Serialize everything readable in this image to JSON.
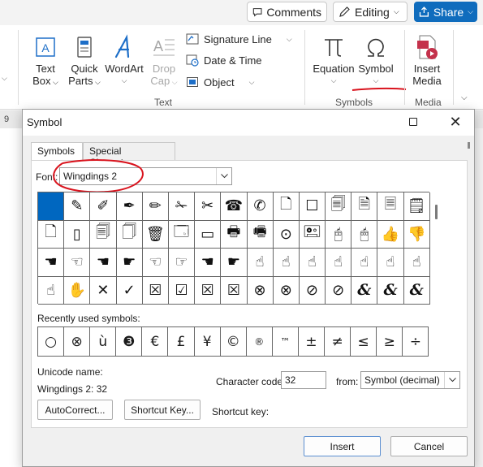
{
  "toolbar": {
    "comments_label": "Comments",
    "editing_label": "Editing",
    "share_label": "Share"
  },
  "ribbon": {
    "text_box": {
      "line1": "Text",
      "line2": "Box"
    },
    "quick_parts": {
      "line1": "Quick",
      "line2": "Parts"
    },
    "wordart": {
      "line1": "WordArt"
    },
    "drop_cap": {
      "line1": "Drop",
      "line2": "Cap"
    },
    "signature_line": "Signature Line",
    "date_time": "Date & Time",
    "object": "Object",
    "equation": "Equation",
    "symbol": "Symbol",
    "insert_media": {
      "line1": "Insert",
      "line2": "Media"
    },
    "groups": {
      "text": "Text",
      "symbols": "Symbols",
      "media": "Media"
    },
    "ruler_number": "9"
  },
  "dialog": {
    "title": "Symbol",
    "tabs": {
      "symbols": "Symbols",
      "special": "Special Characters"
    },
    "font_label": "Font:",
    "font_value": "Wingdings 2",
    "symbols": [
      "",
      "✎",
      "✐",
      "✒",
      "✏",
      "✁",
      "✂",
      "☎",
      "✆",
      "🗋",
      "☐",
      "🗐",
      "🗎",
      "🗏",
      "🗒",
      "🗋",
      "▯",
      "🗐",
      "🗍",
      "🗑",
      "🗔",
      "▭",
      "🖶",
      "🖷",
      "⊙",
      "🖭",
      "🖰",
      "🖱",
      "👍",
      "👎",
      "☚",
      "☜",
      "☚",
      "☛",
      "☜",
      "☞",
      "☚",
      "☛",
      "☝",
      "☝",
      "☝",
      "☝",
      "☝",
      "☝",
      "☝",
      "☝",
      "✋",
      "✕",
      "✓",
      "☒",
      "☑",
      "☒",
      "☒",
      "⊗",
      "⊗",
      "⊘",
      "⊘",
      "&",
      "&",
      "&"
    ],
    "recent_label": "Recently used symbols:",
    "recent": [
      "○",
      "⊗",
      "ù",
      "❸",
      "€",
      "£",
      "¥",
      "©",
      "®",
      "™",
      "±",
      "≠",
      "≤",
      "≥",
      "÷"
    ],
    "unicode_name_label": "Unicode name:",
    "unicode_name_value": "Wingdings 2: 32",
    "char_code_label": "Character code:",
    "char_code_value": "32",
    "from_label": "from:",
    "from_value": "Symbol (decimal)",
    "autocorrect_label": "AutoCorrect...",
    "shortcut_key_button": "Shortcut Key...",
    "shortcut_key_label": "Shortcut key:",
    "insert_label": "Insert",
    "cancel_label": "Cancel"
  },
  "colors": {
    "accent": "#0f6cbd",
    "selection": "#0067c0",
    "annotation_red": "#d9141e",
    "icon_blue": "#1e6fc8",
    "icon_red": "#c4314b"
  }
}
